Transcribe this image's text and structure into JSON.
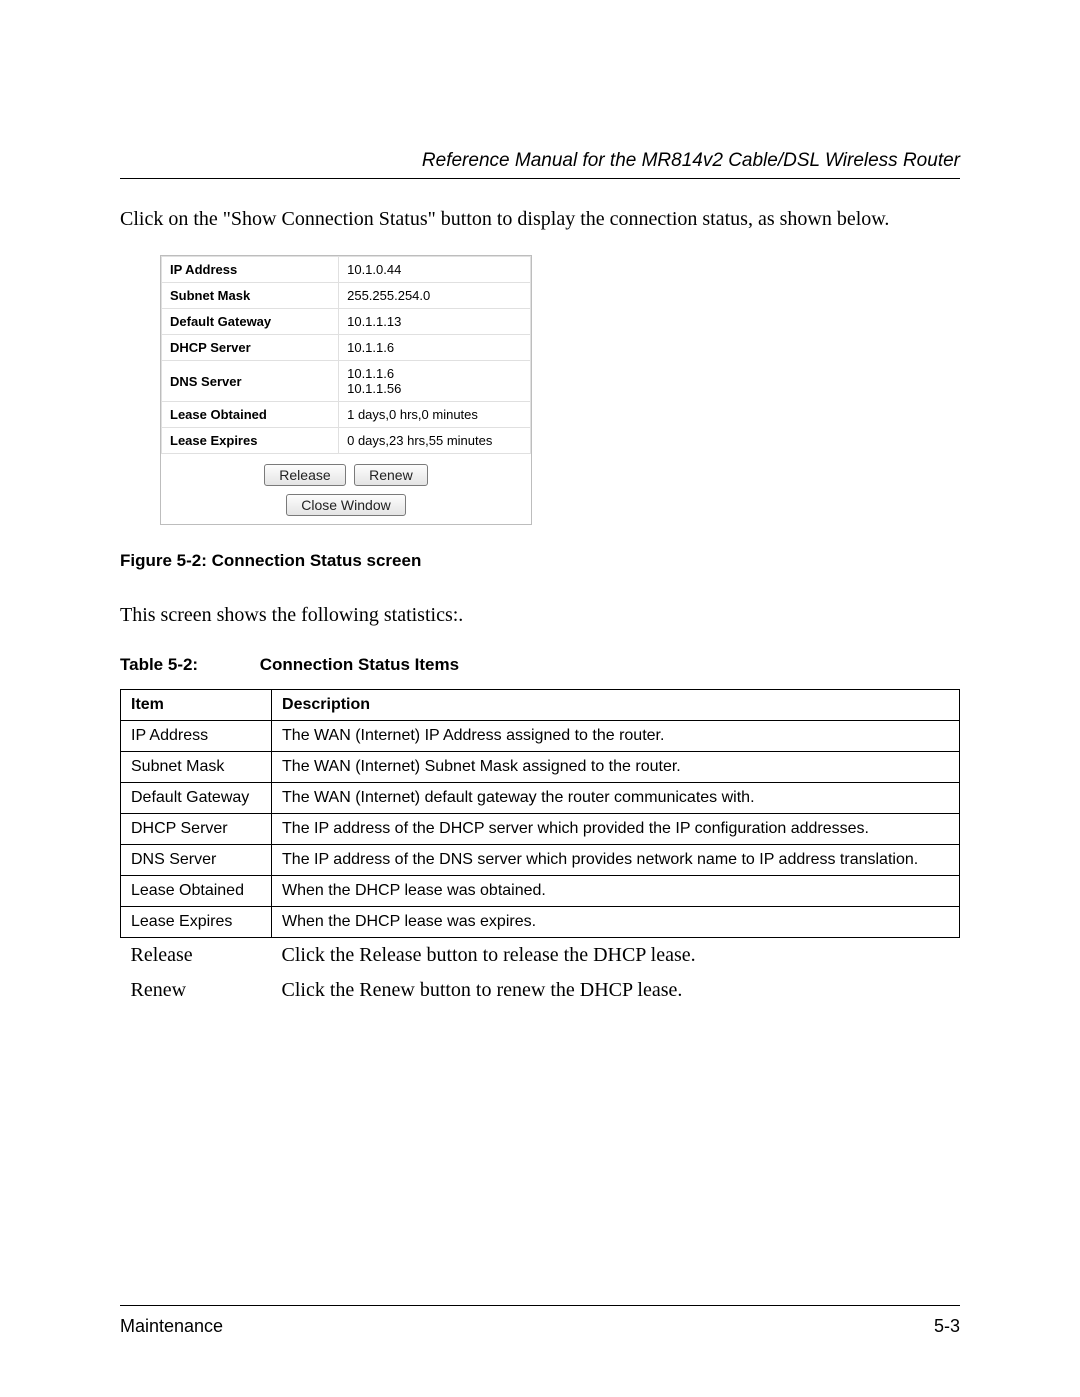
{
  "header": {
    "title": "Reference Manual for the MR814v2 Cable/DSL Wireless Router"
  },
  "intro_text": "Click on the \"Show Connection Status\" button to display the connection status, as shown below.",
  "status_panel": {
    "rows": [
      {
        "label": "IP Address",
        "value": "10.1.0.44"
      },
      {
        "label": "Subnet Mask",
        "value": "255.255.254.0"
      },
      {
        "label": "Default Gateway",
        "value": "10.1.1.13"
      },
      {
        "label": "DHCP Server",
        "value": "10.1.1.6"
      },
      {
        "label": "DNS Server",
        "value": "10.1.1.6\n10.1.1.56"
      },
      {
        "label": "Lease Obtained",
        "value": "1 days,0 hrs,0 minutes"
      },
      {
        "label": "Lease Expires",
        "value": "0 days,23 hrs,55 minutes"
      }
    ],
    "buttons": {
      "release": "Release",
      "renew": "Renew",
      "close": "Close Window"
    }
  },
  "figure_caption": "Figure 5-2:  Connection Status screen",
  "mid_text": "This screen shows the following statistics:.",
  "table_caption_label": "Table 5-2:",
  "table_caption_title": "Connection Status Items",
  "items_table": {
    "headers": {
      "item": "Item",
      "description": "Description"
    },
    "rows": [
      {
        "item": "IP Address",
        "description": "The WAN (Internet) IP Address assigned to the router."
      },
      {
        "item": "Subnet Mask",
        "description": "The WAN (Internet) Subnet Mask assigned to the router."
      },
      {
        "item": "Default Gateway",
        "description": "The WAN (Internet) default gateway the router communicates with."
      },
      {
        "item": "DHCP Server",
        "description": "The IP address of the DHCP server which provided the IP configuration addresses."
      },
      {
        "item": "DNS Server",
        "description": "The IP address of the DNS server which provides network name to IP address translation."
      },
      {
        "item": "Lease Obtained",
        "description": "When the DHCP lease was obtained."
      },
      {
        "item": "Lease Expires",
        "description": "When the DHCP lease was expires."
      }
    ],
    "freeform": [
      {
        "item": "Release",
        "description": "Click the Release button to release the DHCP lease."
      },
      {
        "item": "Renew",
        "description": "Click the Renew button to renew the DHCP lease."
      }
    ]
  },
  "footer": {
    "left": "Maintenance",
    "right": "5-3"
  }
}
